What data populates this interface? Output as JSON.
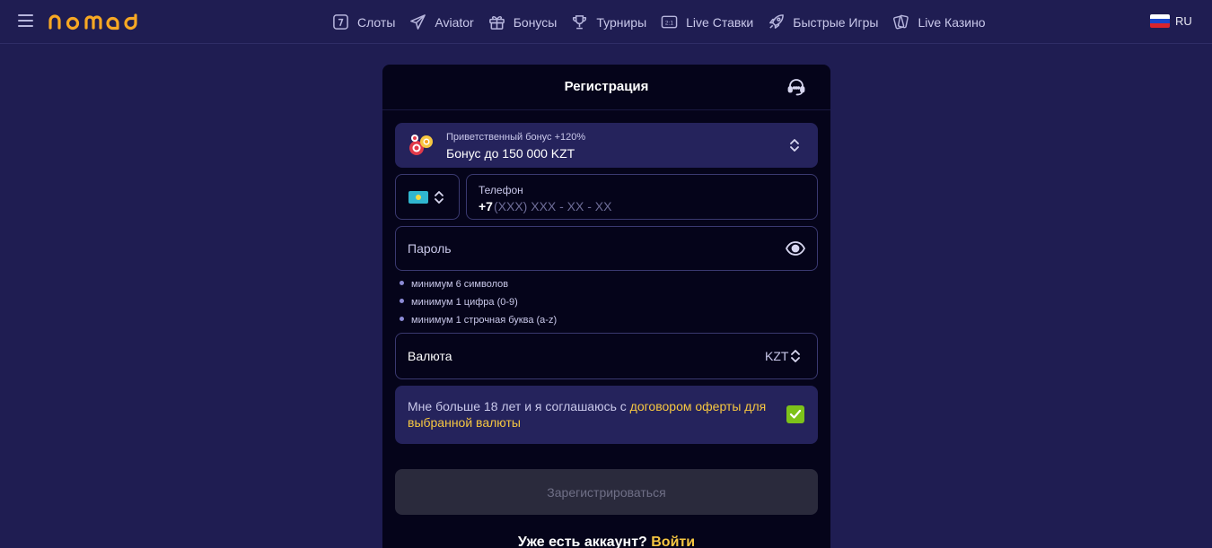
{
  "header": {
    "logo_text": "nomad",
    "nav": [
      {
        "icon": "slot-machine-icon",
        "label": "Слоты"
      },
      {
        "icon": "plane-icon",
        "label": "Aviator"
      },
      {
        "icon": "gift-icon",
        "label": "Бонусы"
      },
      {
        "icon": "trophy-icon",
        "label": "Турниры"
      },
      {
        "icon": "live-score-icon",
        "label": "Live Ставки"
      },
      {
        "icon": "rocket-icon",
        "label": "Быстрые Игры"
      },
      {
        "icon": "cards-icon",
        "label": "Live Казино"
      }
    ],
    "language": "RU"
  },
  "registration": {
    "title": "Регистрация",
    "bonus": {
      "caption": "Приветственный бонус +120%",
      "value": "Бонус до 150 000 KZT"
    },
    "phone": {
      "country_flag": "kazakhstan",
      "label": "Телефон",
      "prefix": "+7",
      "placeholder": "(XXX) XXX - XX - XX"
    },
    "password": {
      "placeholder": "Пароль",
      "rules": [
        "минимум 6 символов",
        "минимум 1 цифра (0-9)",
        "минимум 1 строчная буква (a-z)"
      ]
    },
    "currency": {
      "label": "Валюта",
      "value": "KZT"
    },
    "agreement": {
      "text": "Мне больше 18 лет и я соглашаюсь с ",
      "link": "договором оферты для выбранной валюты",
      "checked": true
    },
    "submit_label": "Зарегистрироваться",
    "login_prompt": "Уже есть аккаунт?",
    "login_link": "Войти"
  },
  "colors": {
    "background": "#1f1d52",
    "panel": "#05041a",
    "accent_yellow": "#f6c741",
    "logo_orange": "#f7a823",
    "checkbox_green": "#7dc21a"
  }
}
